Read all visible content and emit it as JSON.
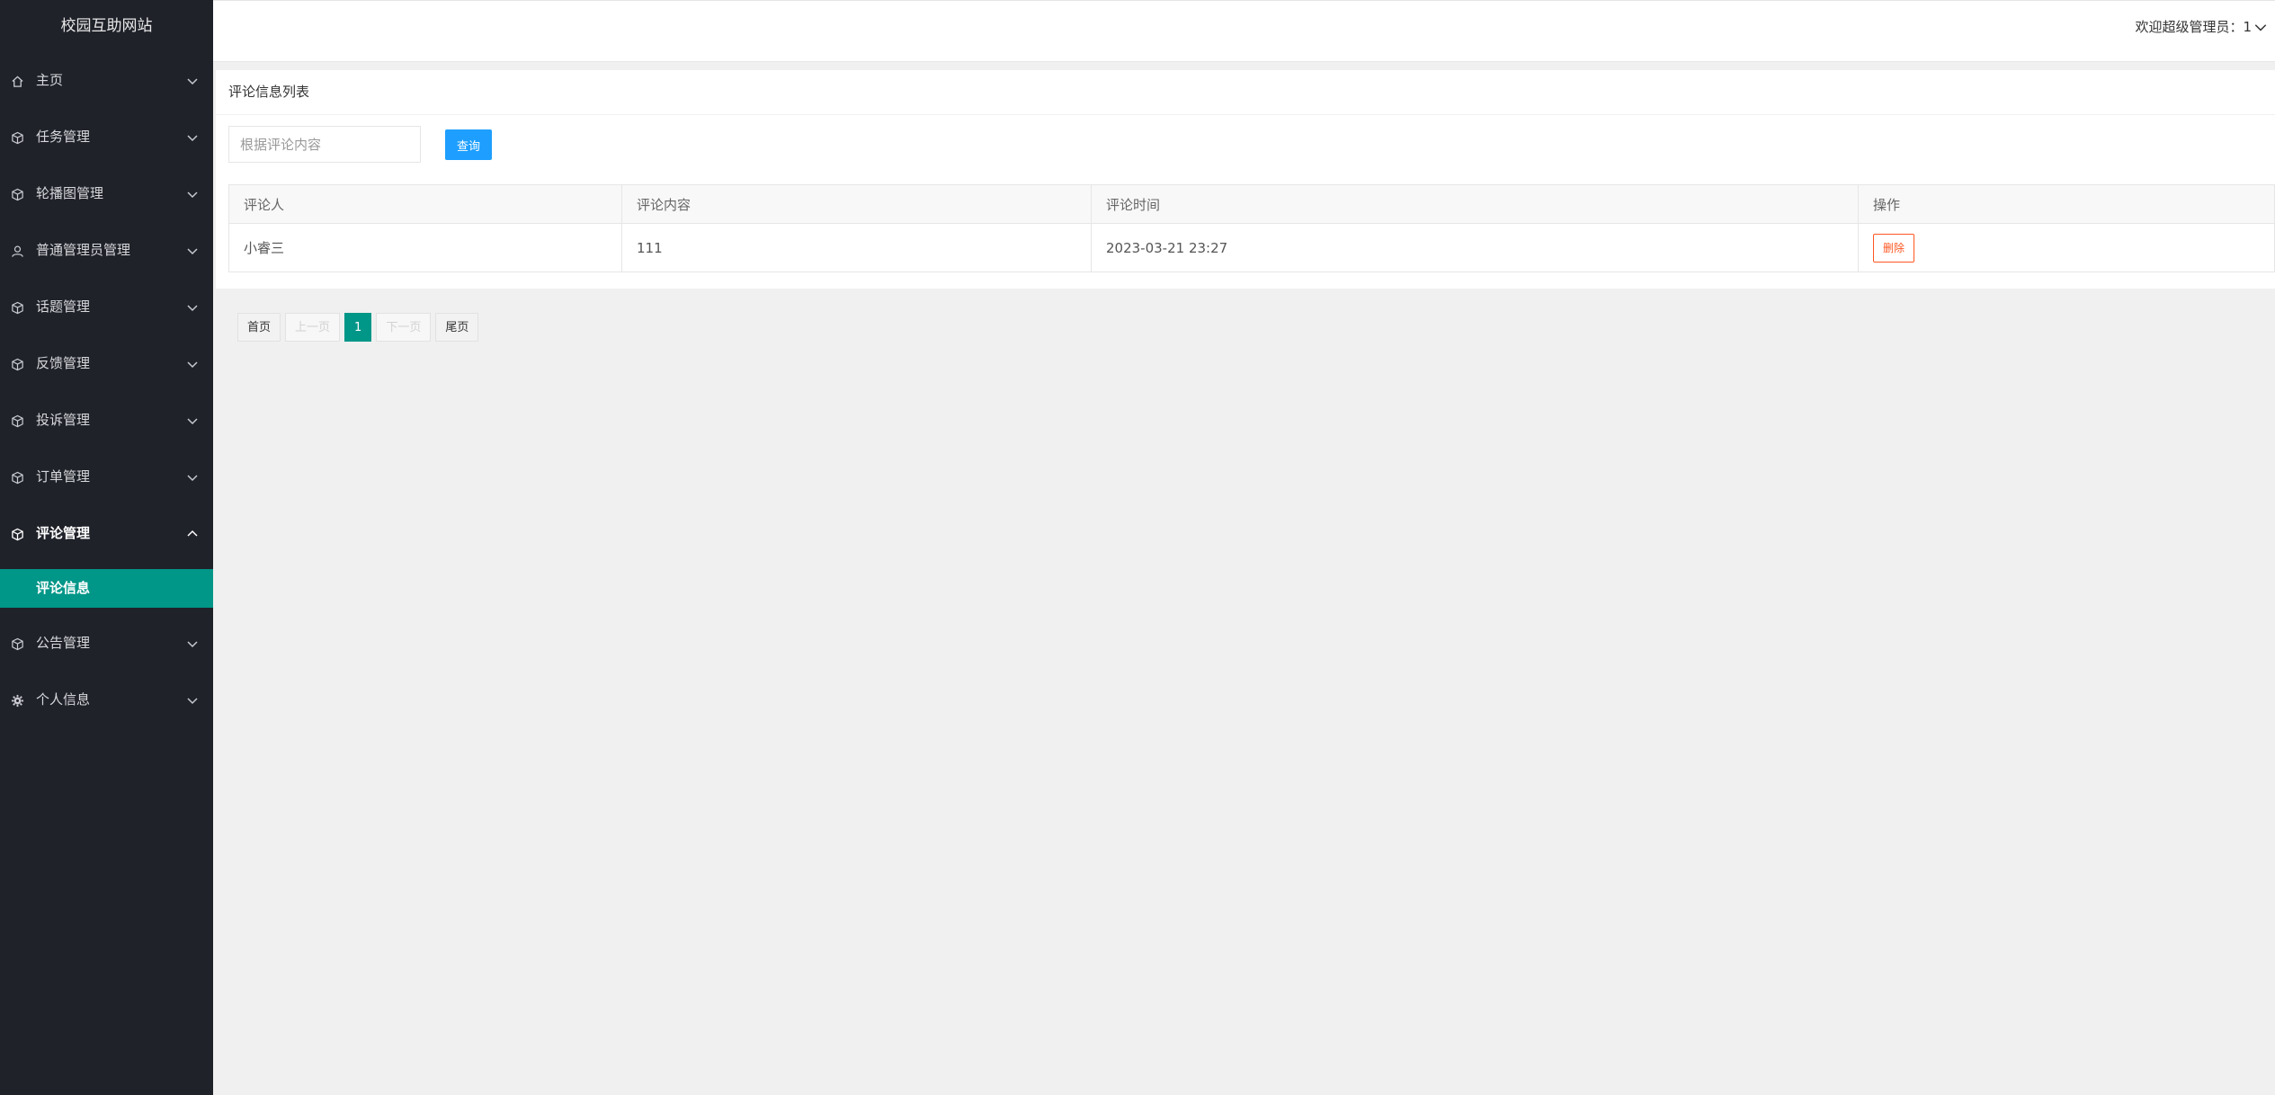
{
  "app": {
    "title": "校园互助网站"
  },
  "sidebar": {
    "items": [
      {
        "label": "主页",
        "icon": "home-icon"
      },
      {
        "label": "任务管理",
        "icon": "cube-icon"
      },
      {
        "label": "轮播图管理",
        "icon": "cube-icon"
      },
      {
        "label": "普通管理员管理",
        "icon": "user-icon"
      },
      {
        "label": "话题管理",
        "icon": "cube-icon"
      },
      {
        "label": "反馈管理",
        "icon": "cube-icon"
      },
      {
        "label": "投诉管理",
        "icon": "cube-icon"
      },
      {
        "label": "订单管理",
        "icon": "cube-icon"
      },
      {
        "label": "评论管理",
        "icon": "cube-icon",
        "expanded": true,
        "children": [
          {
            "label": "评论信息",
            "active": true
          }
        ]
      },
      {
        "label": "公告管理",
        "icon": "cube-icon"
      },
      {
        "label": "个人信息",
        "icon": "gear-icon"
      }
    ]
  },
  "header": {
    "welcome": "欢迎超级管理员：1"
  },
  "main": {
    "panel_title": "评论信息列表",
    "search": {
      "placeholder": "根据评论内容",
      "value": ""
    },
    "query_label": "查询",
    "table": {
      "columns": [
        "评论人",
        "评论内容",
        "评论时间",
        "操作"
      ],
      "rows": [
        {
          "commenter": "小睿三",
          "content": "111",
          "time": "2023-03-21 23:27",
          "action": "删除"
        }
      ]
    }
  },
  "pagination": {
    "first": "首页",
    "prev": "上一页",
    "current": "1",
    "next": "下一页",
    "last": "尾页"
  },
  "colors": {
    "sidebar_bg": "#20222a",
    "active_bg": "#009688",
    "query_button": "#1e9fff",
    "delete_button": "#ff5722"
  }
}
